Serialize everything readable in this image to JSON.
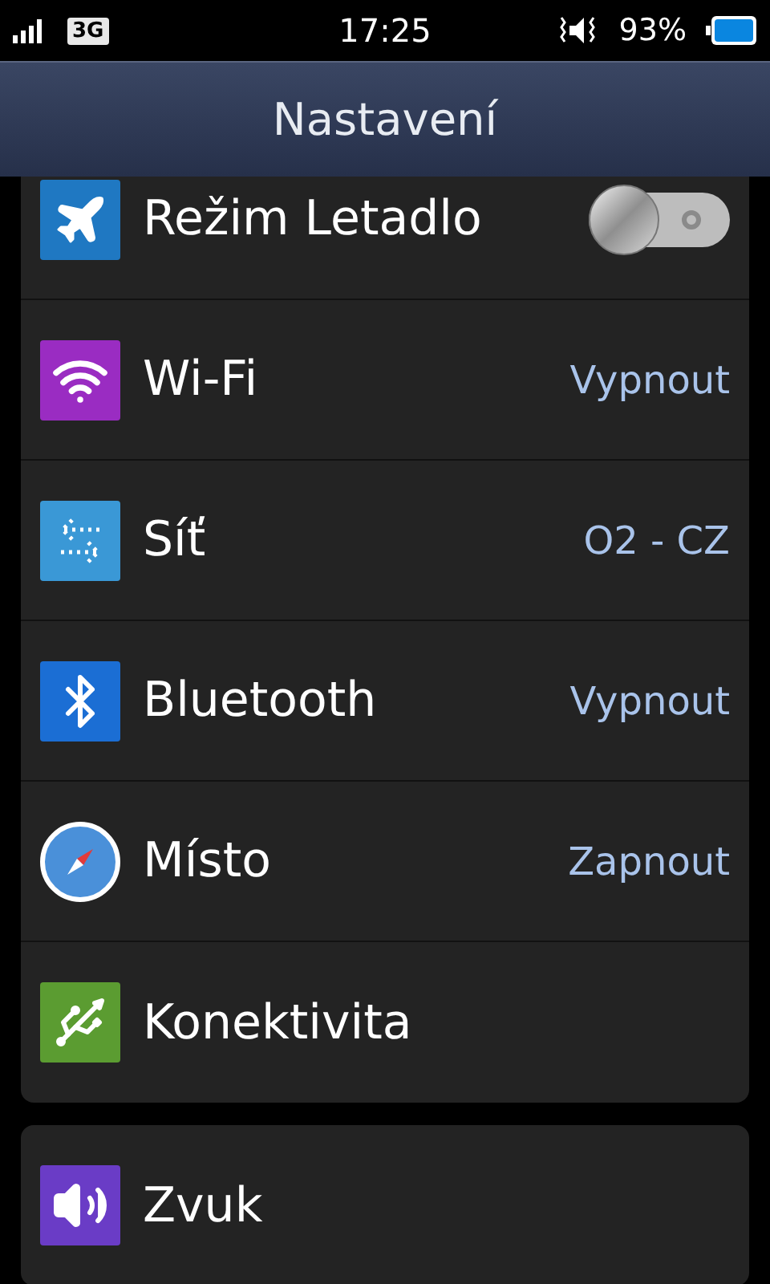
{
  "status_bar": {
    "network": "3G",
    "time": "17:25",
    "battery": "93%"
  },
  "header": {
    "title": "Nastavení"
  },
  "groups": [
    {
      "items": [
        {
          "label": "Režim Letadlo",
          "kind": "toggle",
          "on": false,
          "color": "#1f78c2"
        },
        {
          "label": "Wi-Fi",
          "kind": "value",
          "value": "Vypnout",
          "color": "#9a2cc2"
        },
        {
          "label": "Síť",
          "kind": "value",
          "value": "O2 - CZ",
          "color": "#3a98d6"
        },
        {
          "label": "Bluetooth",
          "kind": "value",
          "value": "Vypnout",
          "color": "#1b6ed4"
        },
        {
          "label": "Místo",
          "kind": "value",
          "value": "Zapnout",
          "color": "#4a90d9"
        },
        {
          "label": "Konektivita",
          "kind": "plain",
          "color": "#5b9c31"
        }
      ]
    },
    {
      "items": [
        {
          "label": "Zvuk",
          "kind": "plain",
          "color": "#6a3cc6"
        }
      ]
    }
  ]
}
